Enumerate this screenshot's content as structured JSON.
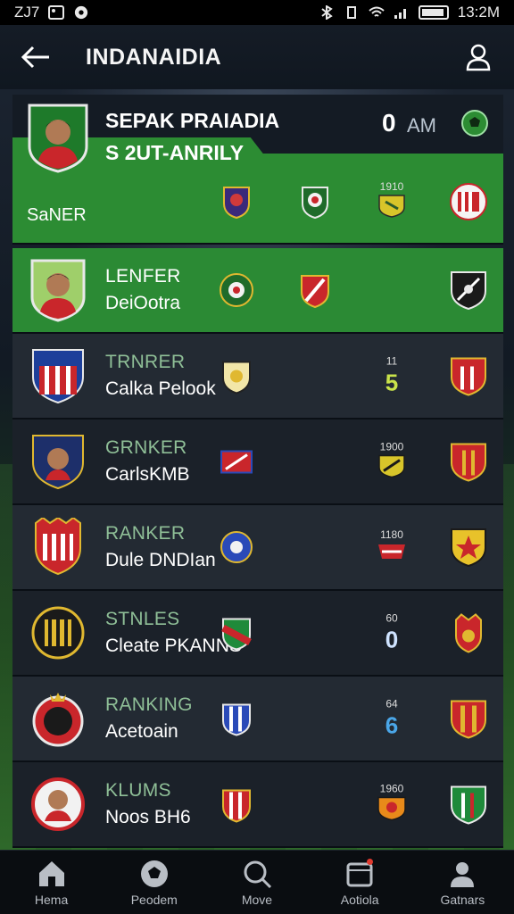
{
  "status_bar": {
    "left_text": "ZJ7",
    "time": "13:2M"
  },
  "header": {
    "title": "INDANAIDIA"
  },
  "featured": {
    "title": "SEPAK PRAIADIA",
    "subtitle": "S 2UT-ANRILY",
    "score": "0",
    "score_suffix": "AM",
    "bottom_label": "SaNER",
    "badge_top_label": "1910"
  },
  "rows": [
    {
      "label": "LENFER",
      "sub": "DeiOotra",
      "score_top": "",
      "score_val": "",
      "score_color": "#ffffff"
    },
    {
      "label": "TRNRER",
      "sub": "Calka Pelook",
      "score_top": "11",
      "score_val": "5",
      "score_color": "#c9e34a"
    },
    {
      "label": "GRNKER",
      "sub": "CarlsKMB",
      "score_top": "1900",
      "score_val": "",
      "score_color": "#ffffff"
    },
    {
      "label": "RANKER",
      "sub": "Dule DNDIan",
      "score_top": "1180",
      "score_val": "",
      "score_color": "#ffffff"
    },
    {
      "label": "STNLES",
      "sub": "Cleate PKANNS",
      "score_top": "60",
      "score_val": "0",
      "score_color": "#cfe3ff"
    },
    {
      "label": "RANKING",
      "sub": "Acetoain",
      "score_top": "64",
      "score_val": "6",
      "score_color": "#4aa6e8"
    },
    {
      "label": "KLUMS",
      "sub": "Noos BH6",
      "score_top": "1960",
      "score_val": "",
      "score_color": "#ffffff"
    }
  ],
  "bottom_nav": [
    {
      "label": "Hema",
      "icon": "home-icon"
    },
    {
      "label": "Peodem",
      "icon": "ball-icon"
    },
    {
      "label": "Move",
      "icon": "search-icon"
    },
    {
      "label": "Aotiola",
      "icon": "calendar-icon"
    },
    {
      "label": "Gatnars",
      "icon": "profile-icon"
    }
  ],
  "colors": {
    "accent_green": "#2c8c33",
    "row_dark": "#232a33",
    "row_darker": "#1b2129"
  }
}
